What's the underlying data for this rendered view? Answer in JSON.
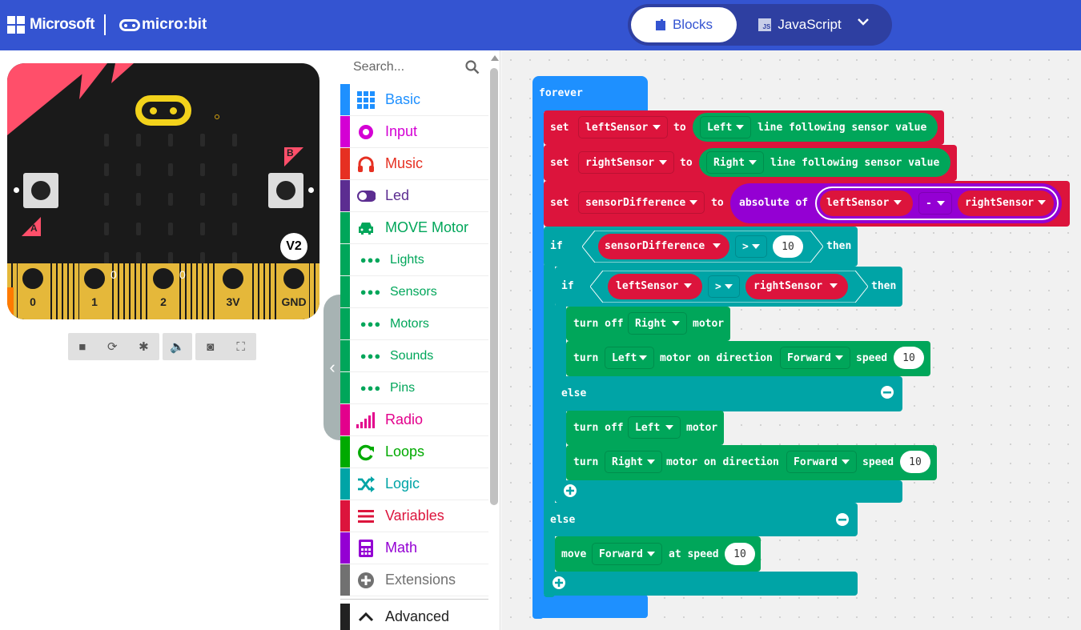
{
  "header": {
    "brand": "Microsoft",
    "product": "micro:bit",
    "tabs": [
      {
        "label": "Blocks",
        "active": true
      },
      {
        "label": "JavaScript",
        "active": false
      }
    ],
    "js_badge": "JS"
  },
  "simulator": {
    "version_badge": "V2",
    "button_a": "A",
    "button_b": "B",
    "pins": [
      "0",
      "1",
      "2",
      "3V",
      "GND"
    ],
    "pin_values": [
      "0",
      "0"
    ],
    "controls": [
      "stop-icon",
      "restart-icon",
      "debug-icon",
      "sound-icon",
      "screenshot-icon",
      "fullscreen-icon"
    ]
  },
  "toolbox": {
    "search_placeholder": "Search...",
    "categories": [
      {
        "label": "Basic",
        "color": "#1e90ff"
      },
      {
        "label": "Input",
        "color": "#d400d4"
      },
      {
        "label": "Music",
        "color": "#e63022"
      },
      {
        "label": "Led",
        "color": "#5c2d91"
      },
      {
        "label": "MOVE Motor",
        "color": "#00a65a"
      },
      {
        "label": "Lights",
        "color": "#00a65a"
      },
      {
        "label": "Sensors",
        "color": "#00a65a"
      },
      {
        "label": "Motors",
        "color": "#00a65a"
      },
      {
        "label": "Sounds",
        "color": "#00a65a"
      },
      {
        "label": "Pins",
        "color": "#00a65a"
      },
      {
        "label": "Radio",
        "color": "#e3008c"
      },
      {
        "label": "Loops",
        "color": "#00aa00"
      },
      {
        "label": "Logic",
        "color": "#00a4a6"
      },
      {
        "label": "Variables",
        "color": "#dc143c"
      },
      {
        "label": "Math",
        "color": "#9400d3"
      },
      {
        "label": "Extensions",
        "color": "#717171"
      },
      {
        "label": "Advanced",
        "color": "#212121"
      }
    ]
  },
  "blocks": {
    "forever": "forever",
    "set": "set",
    "to": "to",
    "var_left": "leftSensor",
    "var_right": "rightSensor",
    "var_diff": "sensorDifference",
    "side_left": "Left",
    "side_right": "Right",
    "line_sensor": "line following sensor value",
    "absolute_of": "absolute of",
    "minus": "-",
    "if": "if",
    "then": "then",
    "else": "else",
    "gt": ">",
    "ten": "10",
    "turn": "turn",
    "off": "off",
    "motor": "motor",
    "motor_on_direction": "motor on direction",
    "forward": "Forward",
    "speed": "speed",
    "move": "move",
    "at_speed": "at speed"
  }
}
